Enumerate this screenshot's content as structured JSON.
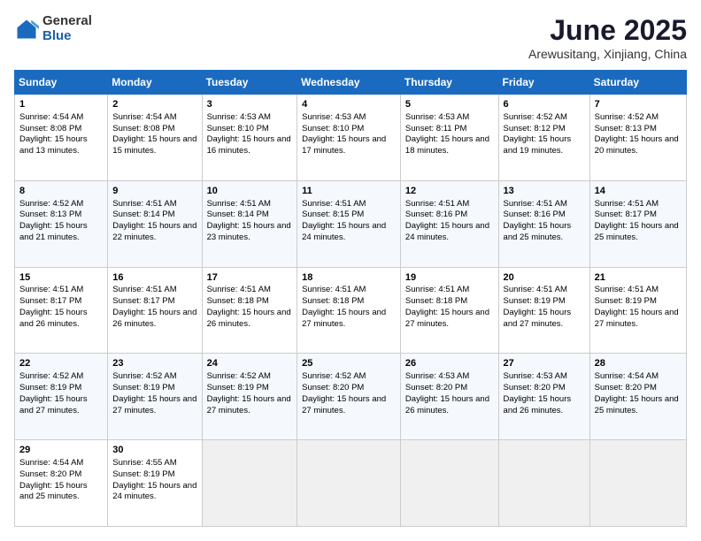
{
  "logo": {
    "general": "General",
    "blue": "Blue"
  },
  "title": "June 2025",
  "subtitle": "Arewusitang, Xinjiang, China",
  "days": [
    "Sunday",
    "Monday",
    "Tuesday",
    "Wednesday",
    "Thursday",
    "Friday",
    "Saturday"
  ],
  "weeks": [
    [
      {
        "day": "1",
        "sunrise": "Sunrise: 4:54 AM",
        "sunset": "Sunset: 8:08 PM",
        "daylight": "Daylight: 15 hours and 13 minutes."
      },
      {
        "day": "2",
        "sunrise": "Sunrise: 4:54 AM",
        "sunset": "Sunset: 8:08 PM",
        "daylight": "Daylight: 15 hours and 15 minutes."
      },
      {
        "day": "3",
        "sunrise": "Sunrise: 4:53 AM",
        "sunset": "Sunset: 8:10 PM",
        "daylight": "Daylight: 15 hours and 16 minutes."
      },
      {
        "day": "4",
        "sunrise": "Sunrise: 4:53 AM",
        "sunset": "Sunset: 8:10 PM",
        "daylight": "Daylight: 15 hours and 17 minutes."
      },
      {
        "day": "5",
        "sunrise": "Sunrise: 4:53 AM",
        "sunset": "Sunset: 8:11 PM",
        "daylight": "Daylight: 15 hours and 18 minutes."
      },
      {
        "day": "6",
        "sunrise": "Sunrise: 4:52 AM",
        "sunset": "Sunset: 8:12 PM",
        "daylight": "Daylight: 15 hours and 19 minutes."
      },
      {
        "day": "7",
        "sunrise": "Sunrise: 4:52 AM",
        "sunset": "Sunset: 8:13 PM",
        "daylight": "Daylight: 15 hours and 20 minutes."
      }
    ],
    [
      {
        "day": "8",
        "sunrise": "Sunrise: 4:52 AM",
        "sunset": "Sunset: 8:13 PM",
        "daylight": "Daylight: 15 hours and 21 minutes."
      },
      {
        "day": "9",
        "sunrise": "Sunrise: 4:51 AM",
        "sunset": "Sunset: 8:14 PM",
        "daylight": "Daylight: 15 hours and 22 minutes."
      },
      {
        "day": "10",
        "sunrise": "Sunrise: 4:51 AM",
        "sunset": "Sunset: 8:14 PM",
        "daylight": "Daylight: 15 hours and 23 minutes."
      },
      {
        "day": "11",
        "sunrise": "Sunrise: 4:51 AM",
        "sunset": "Sunset: 8:15 PM",
        "daylight": "Daylight: 15 hours and 24 minutes."
      },
      {
        "day": "12",
        "sunrise": "Sunrise: 4:51 AM",
        "sunset": "Sunset: 8:16 PM",
        "daylight": "Daylight: 15 hours and 24 minutes."
      },
      {
        "day": "13",
        "sunrise": "Sunrise: 4:51 AM",
        "sunset": "Sunset: 8:16 PM",
        "daylight": "Daylight: 15 hours and 25 minutes."
      },
      {
        "day": "14",
        "sunrise": "Sunrise: 4:51 AM",
        "sunset": "Sunset: 8:17 PM",
        "daylight": "Daylight: 15 hours and 25 minutes."
      }
    ],
    [
      {
        "day": "15",
        "sunrise": "Sunrise: 4:51 AM",
        "sunset": "Sunset: 8:17 PM",
        "daylight": "Daylight: 15 hours and 26 minutes."
      },
      {
        "day": "16",
        "sunrise": "Sunrise: 4:51 AM",
        "sunset": "Sunset: 8:17 PM",
        "daylight": "Daylight: 15 hours and 26 minutes."
      },
      {
        "day": "17",
        "sunrise": "Sunrise: 4:51 AM",
        "sunset": "Sunset: 8:18 PM",
        "daylight": "Daylight: 15 hours and 26 minutes."
      },
      {
        "day": "18",
        "sunrise": "Sunrise: 4:51 AM",
        "sunset": "Sunset: 8:18 PM",
        "daylight": "Daylight: 15 hours and 27 minutes."
      },
      {
        "day": "19",
        "sunrise": "Sunrise: 4:51 AM",
        "sunset": "Sunset: 8:18 PM",
        "daylight": "Daylight: 15 hours and 27 minutes."
      },
      {
        "day": "20",
        "sunrise": "Sunrise: 4:51 AM",
        "sunset": "Sunset: 8:19 PM",
        "daylight": "Daylight: 15 hours and 27 minutes."
      },
      {
        "day": "21",
        "sunrise": "Sunrise: 4:51 AM",
        "sunset": "Sunset: 8:19 PM",
        "daylight": "Daylight: 15 hours and 27 minutes."
      }
    ],
    [
      {
        "day": "22",
        "sunrise": "Sunrise: 4:52 AM",
        "sunset": "Sunset: 8:19 PM",
        "daylight": "Daylight: 15 hours and 27 minutes."
      },
      {
        "day": "23",
        "sunrise": "Sunrise: 4:52 AM",
        "sunset": "Sunset: 8:19 PM",
        "daylight": "Daylight: 15 hours and 27 minutes."
      },
      {
        "day": "24",
        "sunrise": "Sunrise: 4:52 AM",
        "sunset": "Sunset: 8:19 PM",
        "daylight": "Daylight: 15 hours and 27 minutes."
      },
      {
        "day": "25",
        "sunrise": "Sunrise: 4:52 AM",
        "sunset": "Sunset: 8:20 PM",
        "daylight": "Daylight: 15 hours and 27 minutes."
      },
      {
        "day": "26",
        "sunrise": "Sunrise: 4:53 AM",
        "sunset": "Sunset: 8:20 PM",
        "daylight": "Daylight: 15 hours and 26 minutes."
      },
      {
        "day": "27",
        "sunrise": "Sunrise: 4:53 AM",
        "sunset": "Sunset: 8:20 PM",
        "daylight": "Daylight: 15 hours and 26 minutes."
      },
      {
        "day": "28",
        "sunrise": "Sunrise: 4:54 AM",
        "sunset": "Sunset: 8:20 PM",
        "daylight": "Daylight: 15 hours and 25 minutes."
      }
    ],
    [
      {
        "day": "29",
        "sunrise": "Sunrise: 4:54 AM",
        "sunset": "Sunset: 8:20 PM",
        "daylight": "Daylight: 15 hours and 25 minutes."
      },
      {
        "day": "30",
        "sunrise": "Sunrise: 4:55 AM",
        "sunset": "Sunset: 8:19 PM",
        "daylight": "Daylight: 15 hours and 24 minutes."
      },
      null,
      null,
      null,
      null,
      null
    ]
  ]
}
